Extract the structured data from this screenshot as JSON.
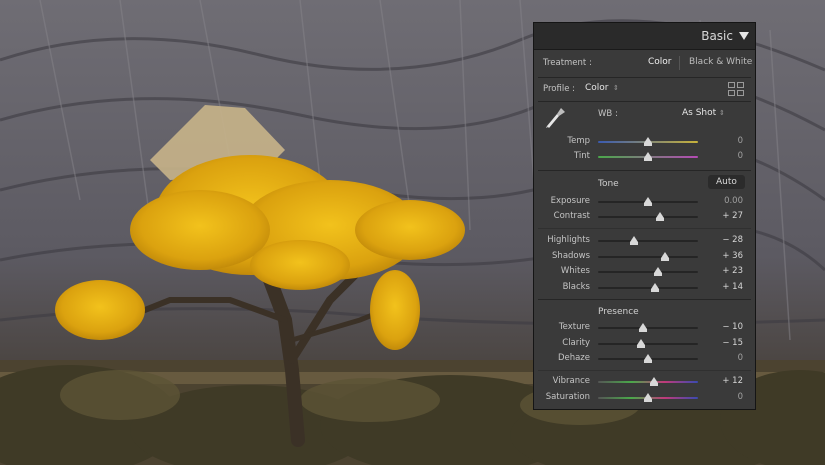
{
  "panel": {
    "title": "Basic",
    "treatment": {
      "label": "Treatment :",
      "color": "Color",
      "bw": "Black & White"
    },
    "profile": {
      "label": "Profile :",
      "value": "Color"
    },
    "wb": {
      "label": "WB :",
      "value": "As Shot"
    },
    "tone": {
      "title": "Tone",
      "auto": "Auto"
    },
    "presence": {
      "title": "Presence"
    },
    "sliders": {
      "temp": {
        "label": "Temp",
        "value": "0",
        "pos": 0.5
      },
      "tint": {
        "label": "Tint",
        "value": "0",
        "pos": 0.5
      },
      "exposure": {
        "label": "Exposure",
        "value": "0.00",
        "pos": 0.5
      },
      "contrast": {
        "label": "Contrast",
        "value": "+ 27",
        "pos": 0.62
      },
      "highlights": {
        "label": "Highlights",
        "value": "− 28",
        "pos": 0.36
      },
      "shadows": {
        "label": "Shadows",
        "value": "+ 36",
        "pos": 0.67
      },
      "whites": {
        "label": "Whites",
        "value": "+ 23",
        "pos": 0.6
      },
      "blacks": {
        "label": "Blacks",
        "value": "+ 14",
        "pos": 0.57
      },
      "texture": {
        "label": "Texture",
        "value": "− 10",
        "pos": 0.45
      },
      "clarity": {
        "label": "Clarity",
        "value": "− 15",
        "pos": 0.43
      },
      "dehaze": {
        "label": "Dehaze",
        "value": "0",
        "pos": 0.5
      },
      "vibrance": {
        "label": "Vibrance",
        "value": "+ 12",
        "pos": 0.56
      },
      "saturation": {
        "label": "Saturation",
        "value": "0",
        "pos": 0.5
      }
    }
  }
}
